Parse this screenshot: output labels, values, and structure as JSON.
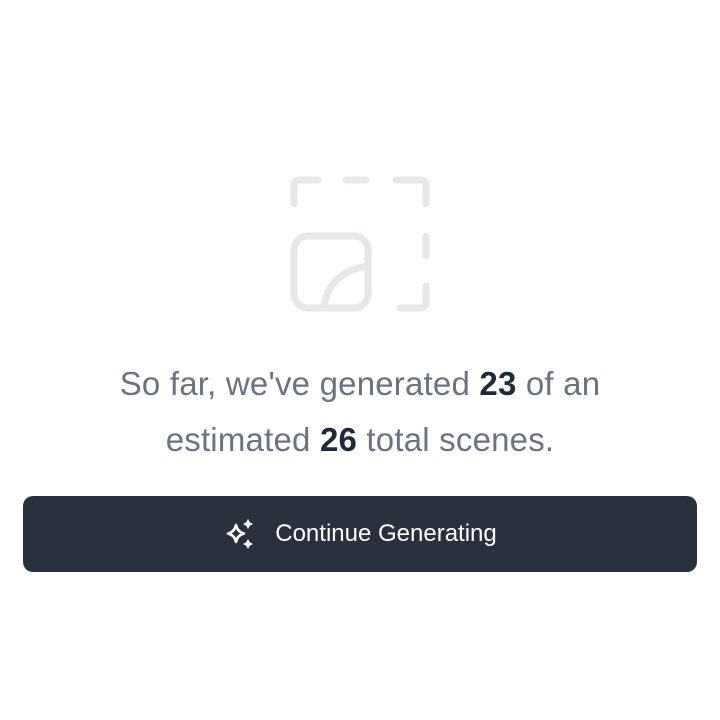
{
  "empty_state": {
    "illustration_icon": "dashed-frame-image-placeholder-icon",
    "message": {
      "lead": "So far, we've generated",
      "generated_count": "23",
      "middle": "of an estimated",
      "estimated_total": "26",
      "tail": "total scenes."
    }
  },
  "actions": {
    "continue_label": "Continue Generating",
    "continue_icon": "sparkles-icon"
  },
  "colors": {
    "button_background": "#2b303e",
    "text_muted": "#6b7280",
    "text_strong": "#1f2937",
    "illustration_stroke": "#e5e7eb"
  }
}
